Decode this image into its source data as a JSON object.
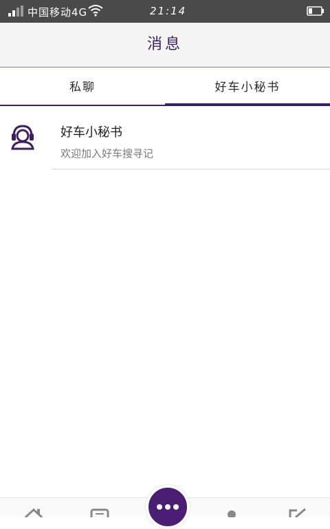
{
  "status_bar": {
    "carrier": "中国移动4G",
    "time": "21:14",
    "signal_icon": "signal-icon",
    "wifi_icon": "wifi-icon",
    "battery_icon": "battery-icon"
  },
  "header": {
    "title": "消息"
  },
  "tabs": [
    {
      "label": "私聊",
      "selected": false
    },
    {
      "label": "好车小秘书",
      "selected": true
    }
  ],
  "messages": [
    {
      "title": "好车小秘书",
      "preview": "欢迎加入好车搜寻记",
      "icon": "support-agent-icon"
    }
  ],
  "bottom_nav": {
    "items": [
      "home-icon",
      "chat-icon",
      "more-icon",
      "person-icon",
      "edit-icon"
    ]
  },
  "colors": {
    "accent": "#3d1d63",
    "center_button": "#4a1f73",
    "status_bar": "#4a4a4a",
    "header_bg": "#f4f4f4"
  }
}
